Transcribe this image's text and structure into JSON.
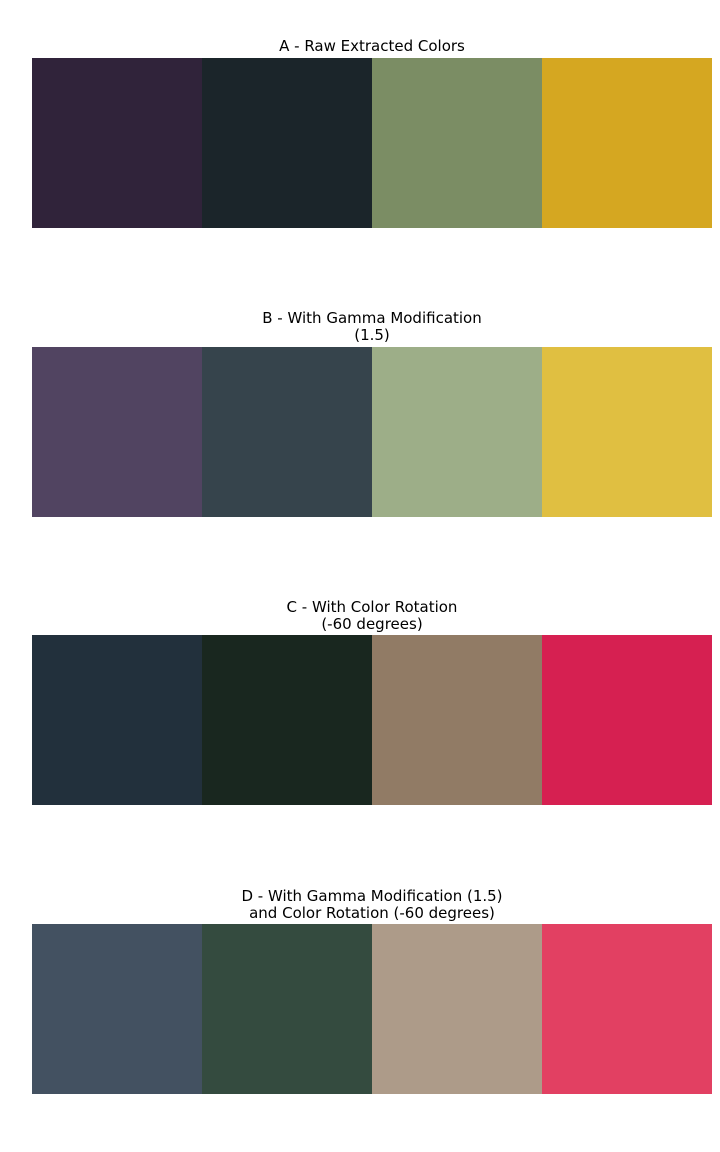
{
  "chart_data": [
    {
      "type": "table",
      "title": "A - Raw Extracted Colors",
      "swatches": [
        "#30233a",
        "#1b252a",
        "#7b8d64",
        "#d5a721"
      ]
    },
    {
      "type": "table",
      "title": "B - With Gamma Modification\n(1.5)",
      "swatches": [
        "#514461",
        "#36444c",
        "#9dae88",
        "#e0bf41"
      ]
    },
    {
      "type": "table",
      "title": "C - With Color Rotation\n(-60 degrees)",
      "swatches": [
        "#22303c",
        "#19271f",
        "#917b65",
        "#d62051"
      ]
    },
    {
      "type": "table",
      "title": "D - With Gamma Modification (1.5)\n and Color Rotation (-60 degrees)",
      "swatches": [
        "#435161",
        "#344b3f",
        "#ad9b89",
        "#e24062"
      ]
    }
  ]
}
